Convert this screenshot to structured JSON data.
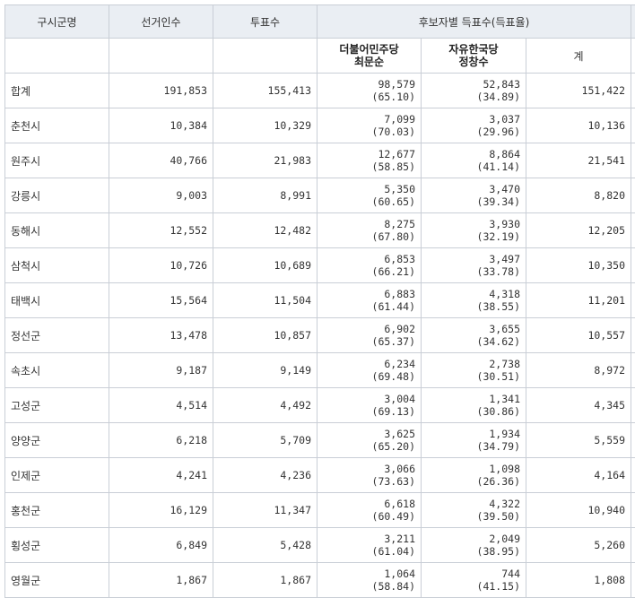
{
  "headers": {
    "region": "구시군명",
    "electors": "선거인수",
    "votes": "투표수",
    "candidate_votes": "후보자별 득표수(득표율)",
    "total": "계"
  },
  "candidates": [
    {
      "party": "더불어민주당",
      "name": "최문순"
    },
    {
      "party": "자유한국당",
      "name": "정창수"
    }
  ],
  "rows": [
    {
      "region": "합계",
      "electors": "191,853",
      "votes": "155,413",
      "c1": "98,579",
      "c1p": "(65.10)",
      "c2": "52,843",
      "c2p": "(34.89)",
      "total": "151,422"
    },
    {
      "region": "춘천시",
      "electors": "10,384",
      "votes": "10,329",
      "c1": "7,099",
      "c1p": "(70.03)",
      "c2": "3,037",
      "c2p": "(29.96)",
      "total": "10,136"
    },
    {
      "region": "원주시",
      "electors": "40,766",
      "votes": "21,983",
      "c1": "12,677",
      "c1p": "(58.85)",
      "c2": "8,864",
      "c2p": "(41.14)",
      "total": "21,541"
    },
    {
      "region": "강릉시",
      "electors": "9,003",
      "votes": "8,991",
      "c1": "5,350",
      "c1p": "(60.65)",
      "c2": "3,470",
      "c2p": "(39.34)",
      "total": "8,820"
    },
    {
      "region": "동해시",
      "electors": "12,552",
      "votes": "12,482",
      "c1": "8,275",
      "c1p": "(67.80)",
      "c2": "3,930",
      "c2p": "(32.19)",
      "total": "12,205"
    },
    {
      "region": "삼척시",
      "electors": "10,726",
      "votes": "10,689",
      "c1": "6,853",
      "c1p": "(66.21)",
      "c2": "3,497",
      "c2p": "(33.78)",
      "total": "10,350"
    },
    {
      "region": "태백시",
      "electors": "15,564",
      "votes": "11,504",
      "c1": "6,883",
      "c1p": "(61.44)",
      "c2": "4,318",
      "c2p": "(38.55)",
      "total": "11,201"
    },
    {
      "region": "정선군",
      "electors": "13,478",
      "votes": "10,857",
      "c1": "6,902",
      "c1p": "(65.37)",
      "c2": "3,655",
      "c2p": "(34.62)",
      "total": "10,557"
    },
    {
      "region": "속초시",
      "electors": "9,187",
      "votes": "9,149",
      "c1": "6,234",
      "c1p": "(69.48)",
      "c2": "2,738",
      "c2p": "(30.51)",
      "total": "8,972"
    },
    {
      "region": "고성군",
      "electors": "4,514",
      "votes": "4,492",
      "c1": "3,004",
      "c1p": "(69.13)",
      "c2": "1,341",
      "c2p": "(30.86)",
      "total": "4,345"
    },
    {
      "region": "양양군",
      "electors": "6,218",
      "votes": "5,709",
      "c1": "3,625",
      "c1p": "(65.20)",
      "c2": "1,934",
      "c2p": "(34.79)",
      "total": "5,559"
    },
    {
      "region": "인제군",
      "electors": "4,241",
      "votes": "4,236",
      "c1": "3,066",
      "c1p": "(73.63)",
      "c2": "1,098",
      "c2p": "(26.36)",
      "total": "4,164"
    },
    {
      "region": "홍천군",
      "electors": "16,129",
      "votes": "11,347",
      "c1": "6,618",
      "c1p": "(60.49)",
      "c2": "4,322",
      "c2p": "(39.50)",
      "total": "10,940"
    },
    {
      "region": "횡성군",
      "electors": "6,849",
      "votes": "5,428",
      "c1": "3,211",
      "c1p": "(61.04)",
      "c2": "2,049",
      "c2p": "(38.95)",
      "total": "5,260"
    },
    {
      "region": "영월군",
      "electors": "1,867",
      "votes": "1,867",
      "c1": "1,064",
      "c1p": "(58.84)",
      "c2": "744",
      "c2p": "(41.15)",
      "total": "1,808"
    }
  ]
}
